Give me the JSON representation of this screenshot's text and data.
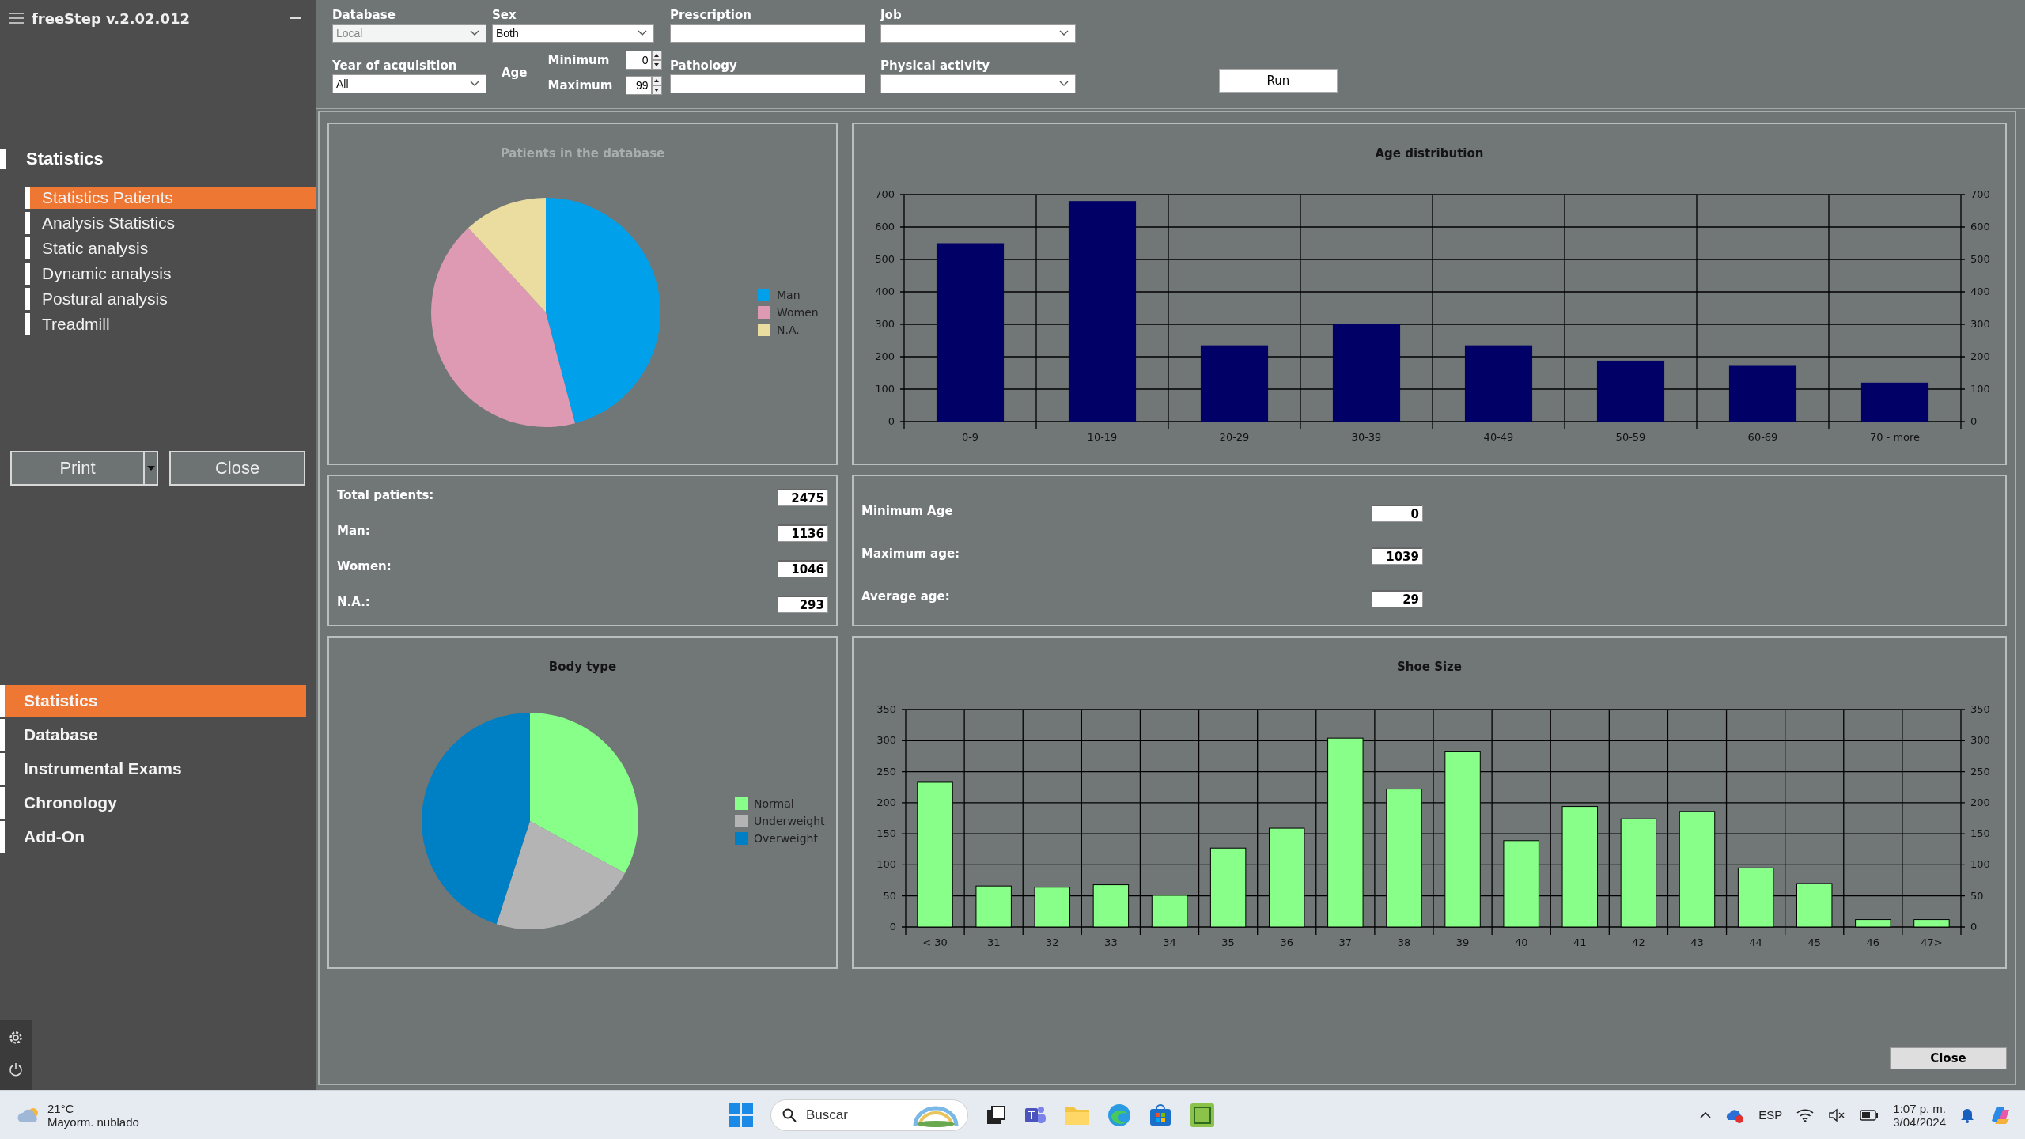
{
  "app": {
    "title": "freeStep v.2.02.012"
  },
  "sidebar": {
    "section": "Statistics",
    "items": [
      {
        "label": "Statistics Patients",
        "selected": true
      },
      {
        "label": "Analysis Statistics",
        "selected": false
      },
      {
        "label": "Static analysis",
        "selected": false
      },
      {
        "label": "Dynamic analysis",
        "selected": false
      },
      {
        "label": "Postural analysis",
        "selected": false
      },
      {
        "label": "Treadmill",
        "selected": false
      }
    ],
    "print_button": "Print",
    "close_button": "Close",
    "nav": [
      {
        "label": "Statistics",
        "selected": true
      },
      {
        "label": "Database",
        "selected": false
      },
      {
        "label": "Instrumental Exams",
        "selected": false
      },
      {
        "label": "Chronology",
        "selected": false
      },
      {
        "label": "Add-On",
        "selected": false
      }
    ]
  },
  "filters": {
    "database": {
      "label": "Database",
      "value": "Local",
      "disabled": true
    },
    "sex": {
      "label": "Sex",
      "value": "Both",
      "disabled": false
    },
    "prescription": {
      "label": "Prescription"
    },
    "job": {
      "label": "Job",
      "disabled": false
    },
    "year": {
      "label": "Year of acquisition",
      "value": "All",
      "disabled": false
    },
    "age": {
      "label": "Age",
      "minimum": {
        "label": "Minimum",
        "value": "0"
      },
      "maximum": {
        "label": "Maximum",
        "value": "99"
      }
    },
    "pathology": {
      "label": "Pathology"
    },
    "physical_activity": {
      "label": "Physical activity",
      "disabled": false
    },
    "run_button": "Run"
  },
  "patients_chart": {
    "chart_data": {
      "type": "pie",
      "title": "Patients in the database",
      "categories": [
        "Man",
        "Women",
        "N.A."
      ],
      "colors": [
        "#00a0ea",
        "#de9ab2",
        "#ebdd9f"
      ],
      "series": [
        {
          "values": [
            45.9,
            42.3,
            11.8
          ]
        }
      ]
    }
  },
  "age_chart": {
    "chart_data": {
      "type": "bar",
      "title": "Age distribution",
      "categories": [
        "0-9",
        "10-19",
        "20-29",
        "30-39",
        "40-49",
        "50-59",
        "60-69",
        "70 - more"
      ],
      "ylim": [
        0,
        700
      ],
      "yticks": [
        0,
        100,
        200,
        300,
        400,
        500,
        600,
        700
      ],
      "grid": true,
      "series": [
        {
          "color": "#000066",
          "values": [
            550,
            680,
            235,
            300,
            235,
            188,
            172,
            120
          ]
        }
      ]
    },
    "right_axis_labels": [
      "700",
      "600",
      "500",
      "400",
      "300",
      "200",
      "100",
      "0"
    ]
  },
  "patient_totals": [
    {
      "label": "Total patients:",
      "value": "2475"
    },
    {
      "label": "Man:",
      "value": "1136"
    },
    {
      "label": "Women:",
      "value": "1046"
    },
    {
      "label": "N.A.:",
      "value": "293"
    }
  ],
  "age_stats": [
    {
      "label": "Minimum Age",
      "value": "0"
    },
    {
      "label": "Maximum age:",
      "value": "1039"
    },
    {
      "label": "Average age:",
      "value": "29"
    }
  ],
  "body_type": {
    "title": "Body type",
    "legend": [
      {
        "label": "Normal",
        "color": "#88ff88"
      },
      {
        "label": "Underweight",
        "color": "#b4b4b4"
      },
      {
        "label": "Overweight",
        "color": "#0080c4"
      }
    ]
  },
  "shoe_chart": {
    "chart_data": {
      "type": "bar",
      "title": "Shoe Size",
      "categories": [
        "< 30",
        "31",
        "32",
        "33",
        "34",
        "35",
        "36",
        "37",
        "38",
        "39",
        "40",
        "41",
        "42",
        "43",
        "44",
        "45",
        "46",
        "47>"
      ],
      "ylim": [
        0,
        350
      ],
      "yticks": [
        {
          "value": 0,
          "label": "0"
        },
        {
          "value": 50,
          "label": "50"
        },
        {
          "value": 100,
          "label": "100"
        },
        {
          "value": 150,
          "label": "150"
        },
        {
          "value": 200,
          "label": "200"
        },
        {
          "value": 250,
          "label": "250"
        },
        {
          "value": 300,
          "label": "300"
        },
        {
          "value": 350,
          "label": "350"
        }
      ],
      "grid": true,
      "series": [
        {
          "color": "#88ff88",
          "values": [
            233,
            66,
            64,
            68,
            51,
            127,
            159,
            304,
            222,
            282,
            139,
            194,
            174,
            186,
            95,
            70,
            12,
            12
          ]
        }
      ]
    },
    "right_axis_labels": [
      "350",
      "300",
      "250",
      "200",
      "150",
      "100",
      "50",
      "0"
    ]
  },
  "close_button": "Close",
  "taskbar": {
    "weather": {
      "temperature": "21°C",
      "condition": "Mayorm. nublado"
    },
    "search": {
      "placeholder": "Buscar"
    },
    "language": "ESP",
    "time": "1:07 p. m.",
    "date": "3/04/2024"
  }
}
